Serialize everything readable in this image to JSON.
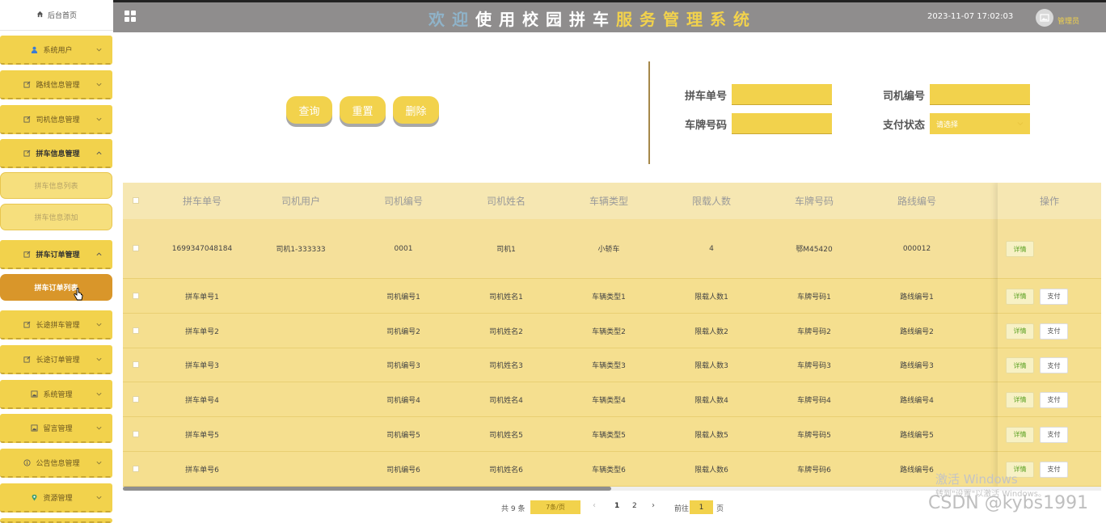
{
  "header": {
    "title_chars": [
      {
        "ch": "欢",
        "color": "#8fb3c9"
      },
      {
        "ch": "迎",
        "color": "#8fb3c9"
      },
      {
        "ch": "使",
        "color": "#ffffff"
      },
      {
        "ch": "用",
        "color": "#ffffff"
      },
      {
        "ch": "校",
        "color": "#ffffff"
      },
      {
        "ch": "园",
        "color": "#ffffff"
      },
      {
        "ch": "拼",
        "color": "#ffffff"
      },
      {
        "ch": "车",
        "color": "#ffffff"
      },
      {
        "ch": "服",
        "color": "#f2d24c"
      },
      {
        "ch": "务",
        "color": "#f2d24c"
      },
      {
        "ch": "管",
        "color": "#f2d24c"
      },
      {
        "ch": "理",
        "color": "#f2d24c"
      },
      {
        "ch": "系",
        "color": "#f2d24c"
      },
      {
        "ch": "统",
        "color": "#f2d24c"
      }
    ],
    "datetime": "2023-11-07 17:02:03",
    "admin": "管理员",
    "grid_icon": "grid-icon",
    "avatar_icon": "image-icon"
  },
  "sidebar": {
    "home": "后台首页",
    "menu": [
      {
        "label": "系统用户",
        "icon": "user-icon",
        "expanded": false
      },
      {
        "label": "路线信息管理",
        "icon": "edit-icon",
        "expanded": false
      },
      {
        "label": "司机信息管理",
        "icon": "edit-icon",
        "expanded": false
      },
      {
        "label": "拼车信息管理",
        "icon": "edit-icon",
        "expanded": true
      },
      {
        "label": "拼车订单管理",
        "icon": "edit-icon",
        "expanded": true
      },
      {
        "label": "长途拼车管理",
        "icon": "edit-icon",
        "expanded": false
      },
      {
        "label": "长途订单管理",
        "icon": "edit-icon",
        "expanded": false
      },
      {
        "label": "系统管理",
        "icon": "image-icon",
        "expanded": false
      },
      {
        "label": "留言管理",
        "icon": "image-icon",
        "expanded": false
      },
      {
        "label": "公告信息管理",
        "icon": "info-icon",
        "expanded": false
      },
      {
        "label": "资源管理",
        "icon": "location-icon",
        "expanded": false
      }
    ],
    "carpool_sub": [
      "拼车信息列表",
      "拼车信息添加"
    ],
    "order_sub": [
      "拼车订单列表"
    ]
  },
  "search": {
    "buttons": [
      "查询",
      "重置",
      "删除"
    ],
    "fields": {
      "order_no": {
        "label": "拼车单号",
        "value": ""
      },
      "driver_no": {
        "label": "司机编号",
        "value": ""
      },
      "plate_no": {
        "label": "车牌号码",
        "value": ""
      },
      "pay_status": {
        "label": "支付状态",
        "value": "请选择"
      }
    }
  },
  "table": {
    "columns": [
      "拼车单号",
      "司机用户",
      "司机编号",
      "司机姓名",
      "车辆类型",
      "限载人数",
      "车牌号码",
      "路线编号",
      "操作"
    ],
    "rows": [
      [
        "1699347048184",
        "司机1-333333",
        "0001",
        "司机1",
        "小轿车",
        "4",
        "鄂M45420",
        "000012"
      ],
      [
        "拼车单号1",
        "",
        "司机编号1",
        "司机姓名1",
        "车辆类型1",
        "限载人数1",
        "车牌号码1",
        "路线编号1"
      ],
      [
        "拼车单号2",
        "",
        "司机编号2",
        "司机姓名2",
        "车辆类型2",
        "限载人数2",
        "车牌号码2",
        "路线编号2"
      ],
      [
        "拼车单号3",
        "",
        "司机编号3",
        "司机姓名3",
        "车辆类型3",
        "限载人数3",
        "车牌号码3",
        "路线编号3"
      ],
      [
        "拼车单号4",
        "",
        "司机编号4",
        "司机姓名4",
        "车辆类型4",
        "限载人数4",
        "车牌号码4",
        "路线编号4"
      ],
      [
        "拼车单号5",
        "",
        "司机编号5",
        "司机姓名5",
        "车辆类型5",
        "限载人数5",
        "车牌号码5",
        "路线编号5"
      ],
      [
        "拼车单号6",
        "",
        "司机编号6",
        "司机姓名6",
        "车辆类型6",
        "限载人数6",
        "车牌号码6",
        "路线编号6"
      ]
    ],
    "detail_label": "详情",
    "pay_label": "支付",
    "pay_visible": [
      false,
      true,
      true,
      true,
      true,
      true,
      true
    ]
  },
  "pagination": {
    "total": "共 9 条",
    "page_size": "7条/页",
    "pages": [
      "1",
      "2"
    ],
    "current": "1",
    "goto_label": "前往",
    "goto_value": "1",
    "page_suffix": "页"
  },
  "watermark": {
    "line1": "激活 Windows",
    "line2": "转到\"设置\"以激活 Windows。",
    "csdn": "CSDN @kybs1991"
  }
}
